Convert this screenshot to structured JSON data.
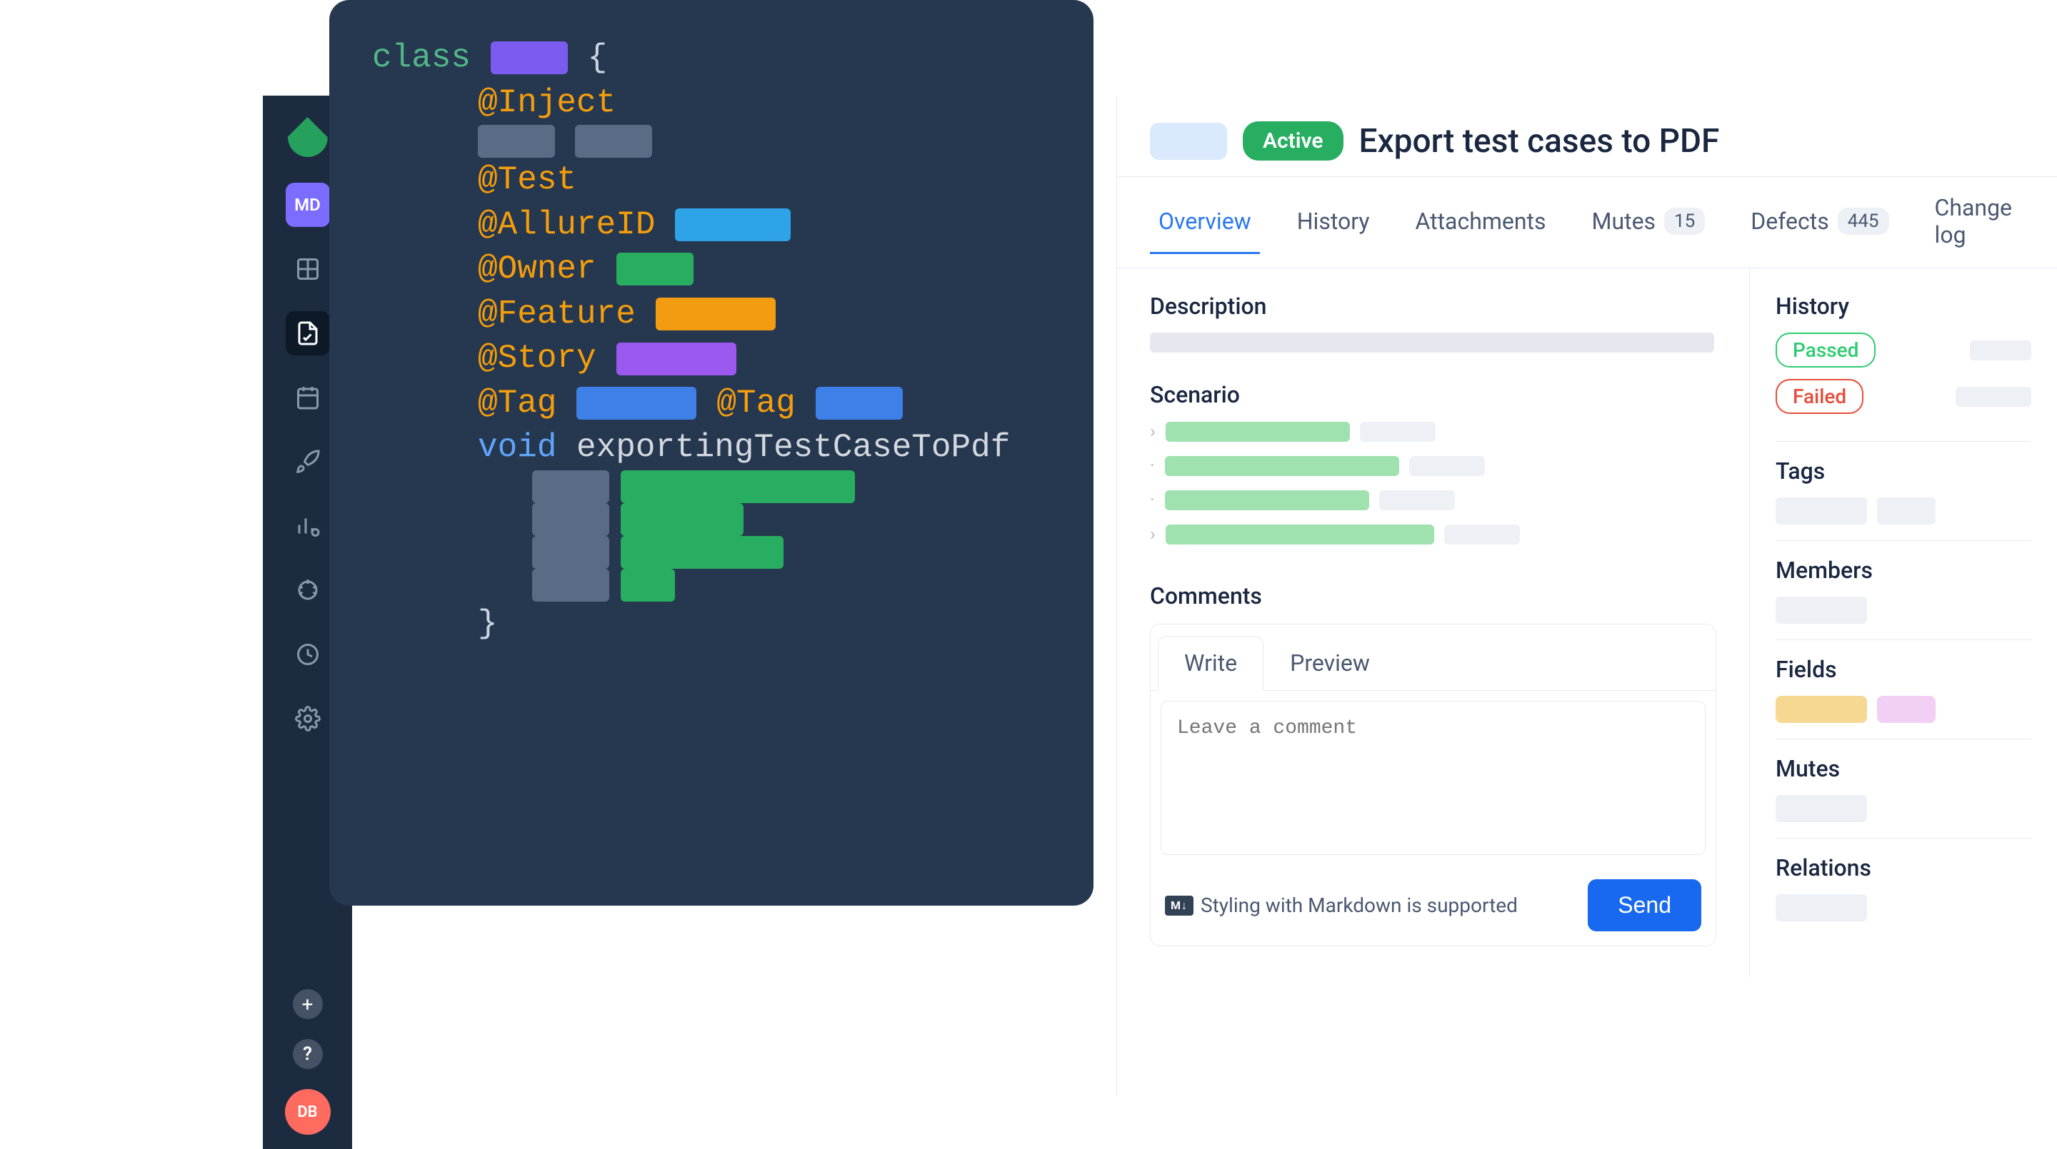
{
  "sidebar": {
    "md_label": "MD",
    "plus": "+",
    "help": "?",
    "db_label": "DB"
  },
  "code": {
    "class_kw": "class",
    "brace_open": " {",
    "inject": "@Inject",
    "test": "@Test",
    "allureId": "@AllureID",
    "owner": "@Owner",
    "feature": "@Feature",
    "story": "@Story",
    "tag": "@Tag",
    "void_kw": "void",
    "method": " exportingTestCaseToPdf",
    "brace_close": "}"
  },
  "header": {
    "active_label": "Active",
    "title": "Export test cases to PDF"
  },
  "tabs": {
    "overview": "Overview",
    "history": "History",
    "attachments": "Attachments",
    "mutes": "Mutes",
    "mutes_count": "15",
    "defects": "Defects",
    "defects_count": "445",
    "changelog": "Change log"
  },
  "main": {
    "description": "Description",
    "scenario": "Scenario",
    "comments": "Comments",
    "write": "Write",
    "preview": "Preview",
    "comment_placeholder": "Leave a comment",
    "markdown_note": "Styling with Markdown is supported",
    "md_badge": "M↓",
    "send": "Send"
  },
  "side": {
    "history": "History",
    "passed": "Passed",
    "failed": "Failed",
    "tags": "Tags",
    "members": "Members",
    "fields": "Fields",
    "mutes": "Mutes",
    "relations": "Relations"
  }
}
